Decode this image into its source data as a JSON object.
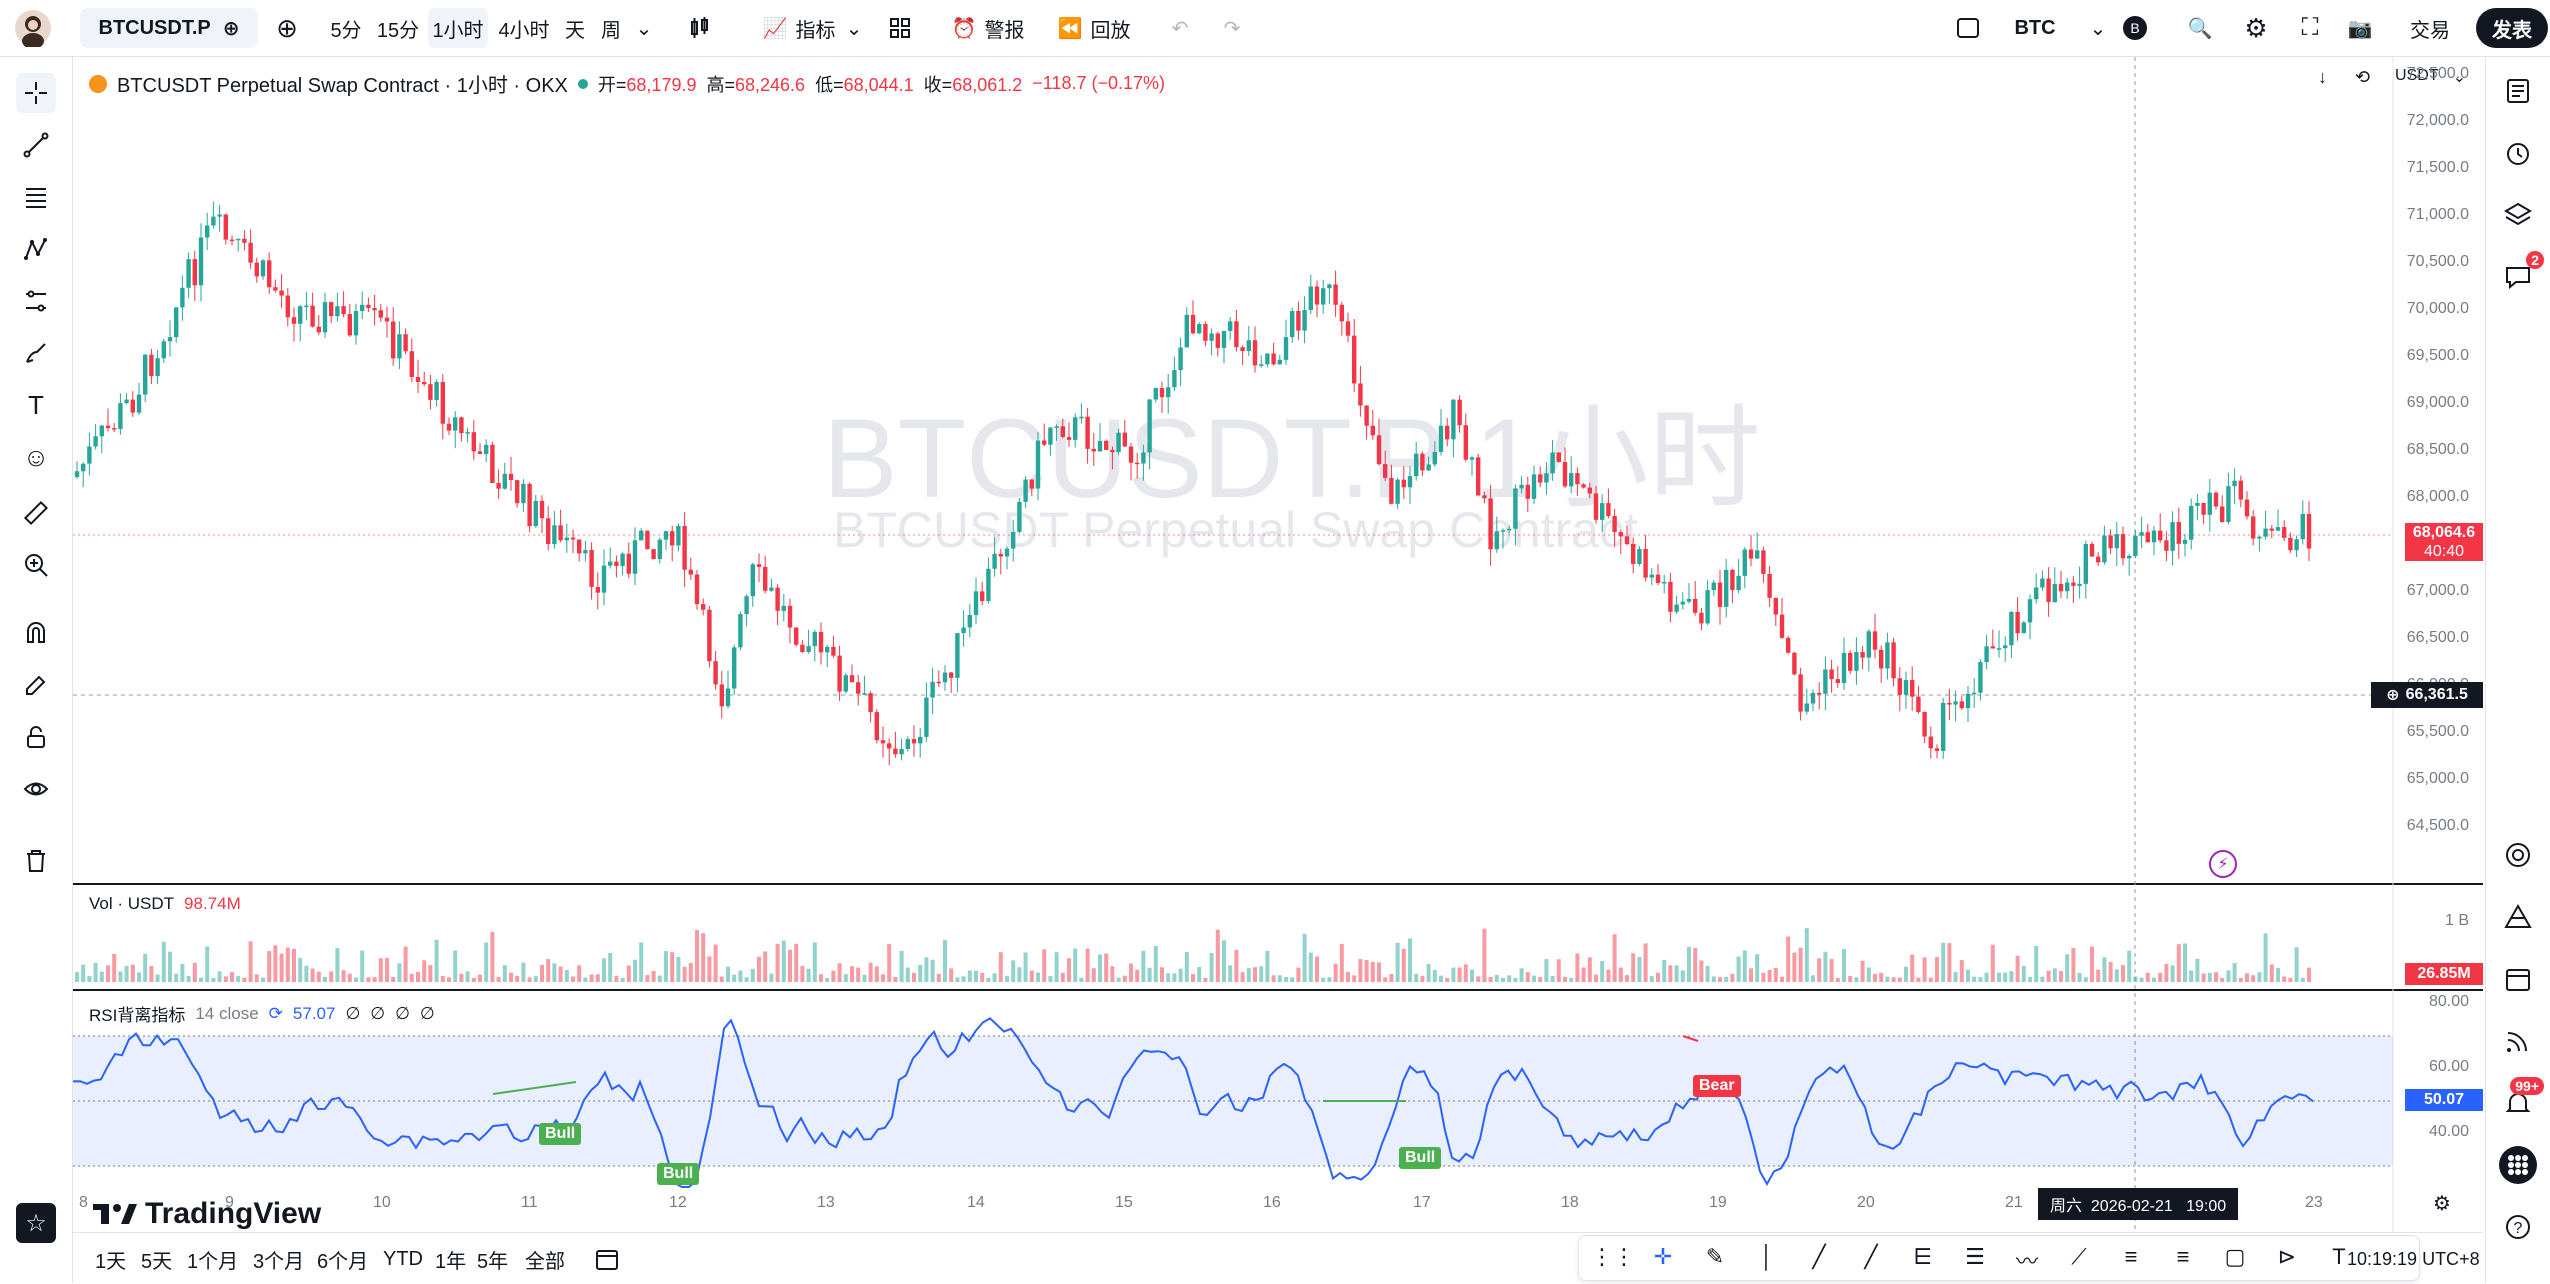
{
  "header": {
    "symbol": "BTCUSDT.P",
    "intervals": [
      "5分",
      "15分",
      "1小时",
      "4小时",
      "天",
      "周"
    ],
    "active_interval": "1小时",
    "indicators_label": "指标",
    "alert_label": "警报",
    "replay_label": "回放",
    "currency": "BTC",
    "currency_badge": "B",
    "trade_label": "交易",
    "publish_label": "发表"
  },
  "legend": {
    "title": "BTCUSDT Perpetual Swap Contract · 1小时 · OKX",
    "open_label": "开=",
    "open": "68,179.9",
    "high_label": "高=",
    "high": "68,246.6",
    "low_label": "低=",
    "low": "68,044.1",
    "close_label": "收=",
    "close": "68,061.2",
    "change": "−118.7 (−0.17%)",
    "quote_currency": "USDT"
  },
  "watermark": {
    "line1": "BTCUSDT.P 1小时",
    "line2": "BTCUSDT Perpetual Swap Contract"
  },
  "price_axis": {
    "labels": [
      "72,500.0",
      "72,000.0",
      "71,500.0",
      "71,000.0",
      "70,500.0",
      "70,000.0",
      "69,500.0",
      "69,000.0",
      "68,500.0",
      "68,000.0",
      "67,500.0",
      "67,000.0",
      "66,500.0",
      "66,000.0",
      "65,500.0",
      "65,000.0",
      "64,500.0"
    ],
    "current_price": "68,064.6",
    "countdown": "40:40",
    "crosshair_price": "66,361.5"
  },
  "volume": {
    "label": "Vol · USDT",
    "value": "98.74M",
    "axis_top": "1 B",
    "current": "26.85M"
  },
  "rsi": {
    "label": "RSI背离指标",
    "params": "14 close",
    "value": "57.07",
    "slots": [
      "∅",
      "∅",
      "∅",
      "∅"
    ],
    "axis": [
      "80.00",
      "60.00",
      "40.00"
    ],
    "current": "50.07",
    "tags": [
      "Bull",
      "Bull",
      "Bull",
      "Bear"
    ]
  },
  "time_axis": {
    "labels": [
      "8",
      "9",
      "10",
      "11",
      "12",
      "13",
      "14",
      "15",
      "16",
      "17",
      "18",
      "19",
      "20",
      "21",
      "23"
    ],
    "crosshair": "周六  2026-02-21   19:00"
  },
  "bottom": {
    "ranges": [
      "1天",
      "5天",
      "1个月",
      "3个月",
      "6个月",
      "YTD",
      "1年",
      "5年",
      "全部"
    ],
    "clock": "10:19:19 UTC+8"
  },
  "brand": "TradingView",
  "badges": {
    "chat": "2",
    "notifications": "99+"
  },
  "colors": {
    "up": "#26a69a",
    "down": "#f23645",
    "rsi": "#2962ff",
    "bull": "#4caf50",
    "bear": "#f23645"
  }
}
